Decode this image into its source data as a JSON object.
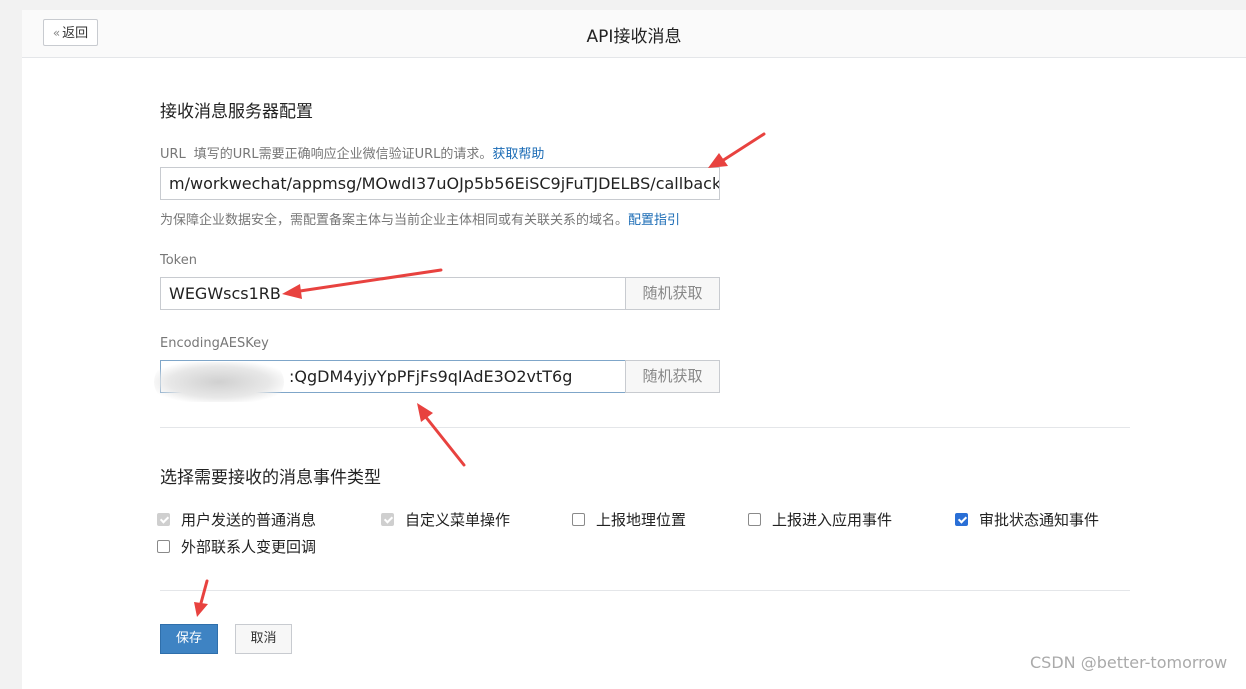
{
  "header": {
    "back_label": "返回",
    "title": "API接收消息"
  },
  "server_config": {
    "section_title": "接收消息服务器配置",
    "url": {
      "label": "URL",
      "hint": "填写的URL需要正确响应企业微信验证URL的请求。",
      "help_link": "获取帮助",
      "value": "m/workwechat/appmsg/MOwdI37uOJp5b56EiSC9jFuTJDELBS/callback",
      "note": "为保障企业数据安全，需配置备案主体与当前企业主体相同或有关联关系的域名。",
      "note_link": "配置指引"
    },
    "token": {
      "label": "Token",
      "value": "WEGWscs1RB",
      "random_button": "随机获取"
    },
    "aes_key": {
      "label": "EncodingAESKey",
      "value": ":QgDM4yjyYpPFjFs9qIAdE3O2vtT6g",
      "random_button": "随机获取"
    }
  },
  "events": {
    "section_title": "选择需要接收的消息事件类型",
    "items": [
      {
        "label": "用户发送的普通消息",
        "state": "checked-disabled"
      },
      {
        "label": "自定义菜单操作",
        "state": "checked-disabled"
      },
      {
        "label": "上报地理位置",
        "state": "unchecked"
      },
      {
        "label": "上报进入应用事件",
        "state": "unchecked"
      },
      {
        "label": "审批状态通知事件",
        "state": "checked"
      },
      {
        "label": "外部联系人变更回调",
        "state": "unchecked"
      }
    ]
  },
  "actions": {
    "save_label": "保存",
    "cancel_label": "取消"
  },
  "watermark": "CSDN @better-tomorrow",
  "colors": {
    "primary_button": "#3e83c3",
    "link": "#1a6bb5",
    "arrow": "#e8423f",
    "checkbox_checked": "#2a6fd6"
  }
}
